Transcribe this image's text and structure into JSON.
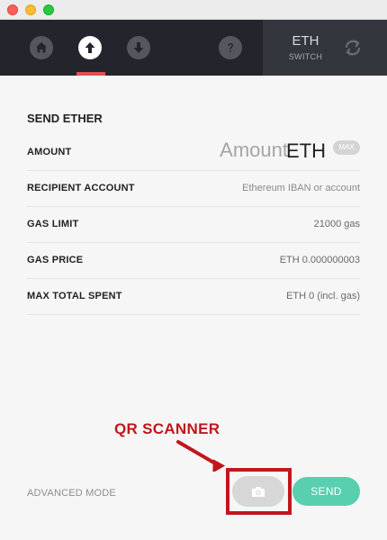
{
  "window": {
    "controls": [
      "close",
      "minimize",
      "maximize"
    ]
  },
  "nav": {
    "items": [
      {
        "name": "home",
        "icon": "home-icon"
      },
      {
        "name": "send",
        "icon": "arrow-up-icon",
        "active": true
      },
      {
        "name": "receive",
        "icon": "arrow-down-icon"
      },
      {
        "name": "help",
        "icon": "question-icon"
      }
    ],
    "currency": {
      "code": "ETH",
      "switch_label": "SWITCH",
      "icon": "switch-icon"
    },
    "colors": {
      "background": "#24252c",
      "active_underline": "#e14f50"
    }
  },
  "form": {
    "title": "SEND ETHER",
    "amount": {
      "label": "AMOUNT",
      "placeholder": "Amount",
      "value": "",
      "unit": "ETH",
      "max_label": "MAX"
    },
    "recipient": {
      "label": "RECIPIENT ACCOUNT",
      "placeholder": "Ethereum IBAN or account",
      "value": ""
    },
    "gas_limit": {
      "label": "GAS LIMIT",
      "value": "21000 gas"
    },
    "gas_price": {
      "label": "GAS PRICE",
      "value": "ETH 0.000000003"
    },
    "max_total": {
      "label": "MAX TOTAL SPENT",
      "value": "ETH 0 (incl. gas)"
    }
  },
  "footer": {
    "advanced_label": "ADVANCED MODE",
    "camera_icon": "camera-icon",
    "send_label": "SEND",
    "send_color": "#58cfae"
  },
  "annotation": {
    "label": "QR SCANNER",
    "color": "#c0171d"
  }
}
